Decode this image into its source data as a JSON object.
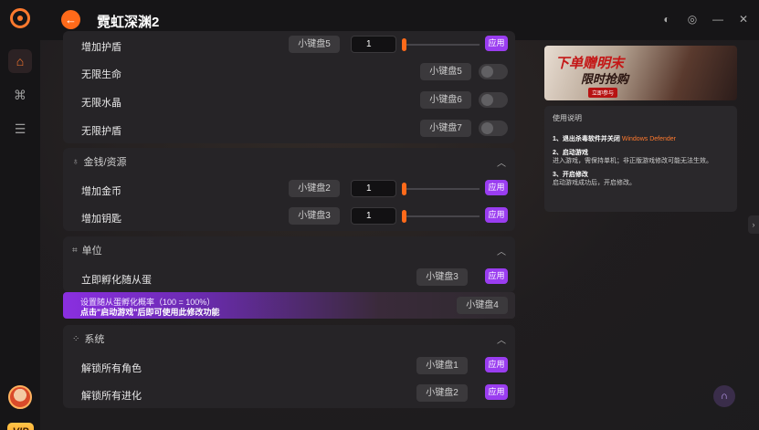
{
  "app": {
    "title": "霓虹深渊2"
  },
  "window": {
    "ctrl1": "◐",
    "ctrl2": "◎",
    "ctrl3": "—",
    "ctrl4": "✕"
  },
  "sidebar": {
    "home": "⌂",
    "gamepad": "⌘",
    "box": "☰",
    "vip": "VIP"
  },
  "rows_top": {
    "partial_name": "增加护盾",
    "partial_key": "小键盘5",
    "partial_value": "1",
    "partial_apply": "应用",
    "items": [
      {
        "name": "无限生命",
        "key": "小键盘5"
      },
      {
        "name": "无限水晶",
        "key": "小键盘6"
      },
      {
        "name": "无限护盾",
        "key": "小键盘7"
      }
    ]
  },
  "section_money": {
    "title": "金钱/资源",
    "items": [
      {
        "name": "增加金币",
        "key": "小键盘2",
        "value": "1",
        "apply": "应用"
      },
      {
        "name": "增加钥匙",
        "key": "小键盘3",
        "value": "1",
        "apply": "应用"
      }
    ]
  },
  "section_unit": {
    "title": "单位",
    "items": [
      {
        "name": "立即孵化随从蛋",
        "key": "小键盘3",
        "apply": "应用"
      }
    ],
    "banner_line1": "设置随从蛋孵化概率（100 = 100%）",
    "banner_line2": "点击\"启动游戏\"后即可使用此修改功能",
    "banner_key": "小键盘4"
  },
  "section_system": {
    "title": "系统",
    "items": [
      {
        "name": "解锁所有角色",
        "key": "小键盘1",
        "apply": "应用"
      },
      {
        "name": "解锁所有进化",
        "key": "小键盘2",
        "apply": "应用"
      }
    ]
  },
  "ad": {
    "line1": "下单赠明末",
    "line2": "限时抢购",
    "line3": "立即参与"
  },
  "info": {
    "heading": "使用说明",
    "step1_title": "1、退出杀毒软件并关闭",
    "step1_highlight": "Windows Defender",
    "step2_title": "2、启动游戏",
    "step2_desc": "进入游戏，需保持单机；非正版游戏修改可能无法生效。",
    "step3_title": "3、开启修改",
    "step3_desc": "启动游戏成功后，开启修改。"
  }
}
